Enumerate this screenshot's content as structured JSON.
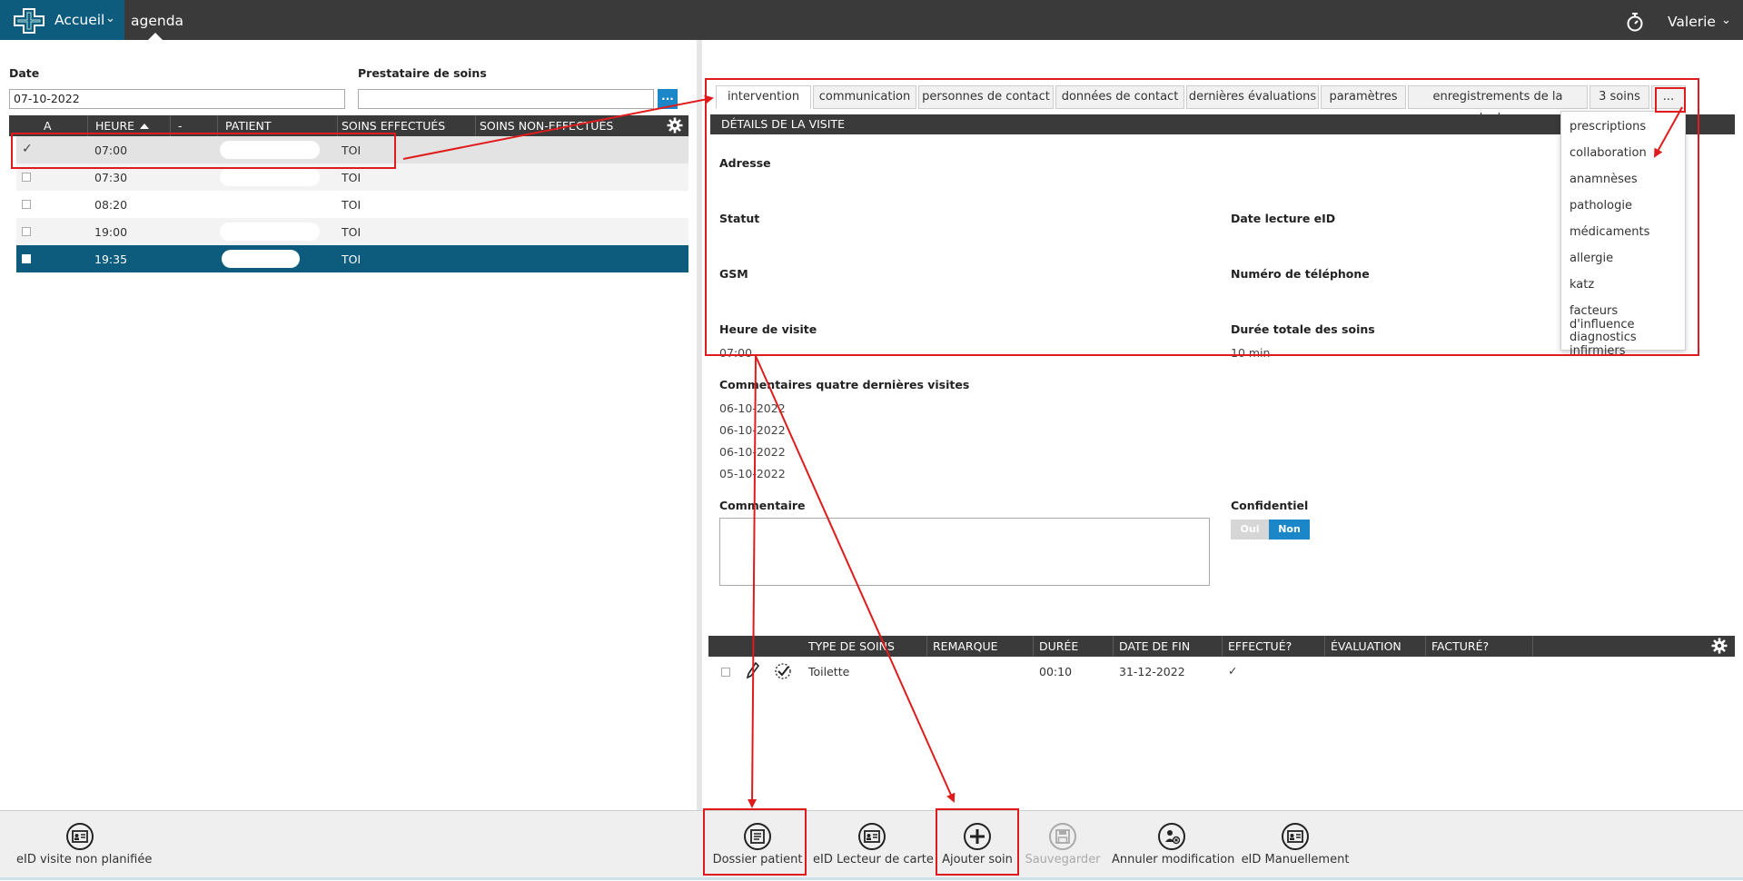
{
  "topbar": {
    "home_label": "Accueil",
    "module_label": "agenda",
    "user_name": "Valerie"
  },
  "filters": {
    "date_label": "Date",
    "date_value": "07-10-2022",
    "provider_label": "Prestataire de soins",
    "provider_value": "",
    "browse_label": "..."
  },
  "agenda_table": {
    "columns": [
      "A",
      "HEURE",
      "-",
      "PATIENT",
      "SOINS EFFECTUÉS",
      "SOINS NON-EFFECTUÉS"
    ],
    "rows": [
      {
        "time": "07:00",
        "done": "TOI",
        "checked": true
      },
      {
        "time": "07:30",
        "done": "TOI",
        "checked": false
      },
      {
        "time": "08:20",
        "done": "TOI",
        "checked": false
      },
      {
        "time": "19:00",
        "done": "TOI",
        "checked": false
      },
      {
        "time": "19:35",
        "done": "TOI",
        "checked": false
      }
    ]
  },
  "tabs": [
    "intervention",
    "communication",
    "personnes de contact",
    "données de contact",
    "dernières évaluations",
    "paramètres",
    "enregistrements de la douleur",
    "3 soins",
    "..."
  ],
  "more_menu": [
    "prescriptions",
    "collaboration",
    "anamnèses",
    "pathologie",
    "médicaments",
    "allergie",
    "katz",
    "facteurs d'influence",
    "diagnostics infirmiers"
  ],
  "visit": {
    "section_title": "DÉTAILS DE LA VISITE",
    "address_label": "Adresse",
    "status_label": "Statut",
    "eid_date_label": "Date lecture eID",
    "gsm_label": "GSM",
    "phone_label": "Numéro de téléphone",
    "visit_time_label": "Heure de visite",
    "visit_time_value": "07:00",
    "duration_label": "Durée totale des soins",
    "duration_value": "10 min",
    "last_comments_label": "Commentaires quatre dernières visites",
    "last_comments": [
      "06-10-2022",
      "06-10-2022",
      "06-10-2022",
      "05-10-2022"
    ],
    "comment_label": "Commentaire",
    "confidential_label": "Confidentiel",
    "toggle_yes": "Oui",
    "toggle_no": "Non"
  },
  "care_table": {
    "columns": [
      "TYPE DE SOINS",
      "REMARQUE",
      "DURÉE",
      "DATE DE FIN",
      "EFFECTUÉ?",
      "ÉVALUATION",
      "FACTURÉ?"
    ],
    "rows": [
      {
        "type": "Toilette",
        "remark": "",
        "duration": "00:10",
        "end_date": "31-12-2022",
        "done": "✓",
        "evaluation": "",
        "billed": ""
      }
    ]
  },
  "toolbar": {
    "eid_unplanned": "eID visite non planifiée",
    "patient_file": "Dossier patient",
    "eid_reader": "eID Lecteur de carte",
    "add_care": "Ajouter soin",
    "save": "Sauvegarder",
    "cancel_change": "Annuler modification",
    "eid_manual": "eID Manuellement"
  },
  "colors": {
    "accent": "#0d5c7e",
    "header_dark": "#3a3a3a",
    "toggle_on": "#1b87c8",
    "annotation": "#e01b1b"
  }
}
